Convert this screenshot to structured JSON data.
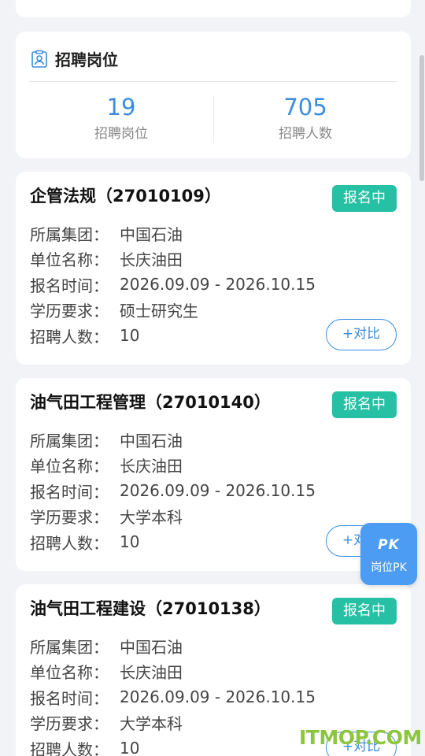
{
  "summary": {
    "title": "招聘岗位",
    "icon": "clipboard-person-icon",
    "stats": [
      {
        "value": "19",
        "label": "招聘岗位"
      },
      {
        "value": "705",
        "label": "招聘人数"
      }
    ]
  },
  "labels": {
    "group": "所属集团：",
    "unit": "单位名称：",
    "time": "报名时间：",
    "education": "学历要求：",
    "count": "招聘人数："
  },
  "jobs": [
    {
      "title": "企管法规（27010109）",
      "status": "报名中",
      "group": "中国石油",
      "unit": "长庆油田",
      "time": "2026.09.09 - 2026.10.15",
      "education": "硕士研究生",
      "count": "10",
      "compare_label": "+对比"
    },
    {
      "title": "油气田工程管理（27010140）",
      "status": "报名中",
      "group": "中国石油",
      "unit": "长庆油田",
      "time": "2026.09.09 - 2026.10.15",
      "education": "大学本科",
      "count": "10",
      "compare_label": "+对比"
    },
    {
      "title": "油气田工程建设（27010138）",
      "status": "报名中",
      "group": "中国石油",
      "unit": "长庆油田",
      "time": "2026.09.09 - 2026.10.15",
      "education": "大学本科",
      "count": "10",
      "compare_label": "+对比"
    }
  ],
  "fab": {
    "icon_text": "PK",
    "label": "岗位PK"
  },
  "watermark": "ITMOP.COM",
  "colors": {
    "accent": "#3a8dde",
    "badge": "#26c0a4",
    "fab": "#4b9cf2",
    "watermark": "#8cc63f"
  }
}
